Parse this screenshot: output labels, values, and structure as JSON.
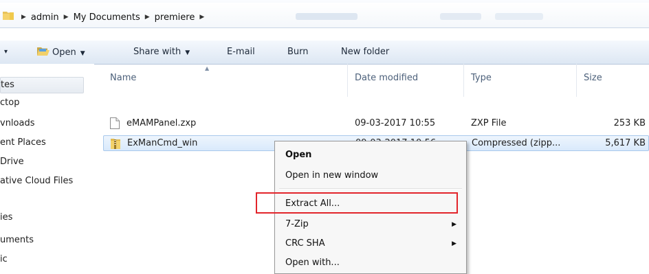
{
  "address_bar": {
    "crumbs": [
      "admin",
      "My Documents",
      "premiere"
    ]
  },
  "toolbar": {
    "organize_arrow": "▾",
    "open_label": "Open",
    "share_with_label": "Share with",
    "email_label": "E-mail",
    "burn_label": "Burn",
    "new_folder_label": "New folder"
  },
  "nav_pane": {
    "items": [
      "tes",
      "ctop",
      "vnloads",
      "ent Places",
      "Drive",
      "ative Cloud Files",
      "ies",
      "uments",
      "ic"
    ]
  },
  "columns": {
    "name": "Name",
    "date_modified": "Date modified",
    "type": "Type",
    "size": "Size"
  },
  "files": [
    {
      "name": "eMAMPanel.zxp",
      "date": "09-03-2017 10:55",
      "type": "ZXP File",
      "size": "253 KB",
      "icon": "document-icon"
    },
    {
      "name": "ExManCmd_win",
      "date": "09-03-2017 10:56",
      "type": "Compressed (zipp...",
      "size": "5,617 KB",
      "icon": "zip-folder-icon"
    }
  ],
  "context_menu": {
    "items": [
      "Open",
      "Open in new window",
      "Extract All...",
      "7-Zip",
      "CRC SHA",
      "Open with..."
    ]
  },
  "colors": {
    "highlight": "#e2242a",
    "selection": "#d9e9fb"
  }
}
